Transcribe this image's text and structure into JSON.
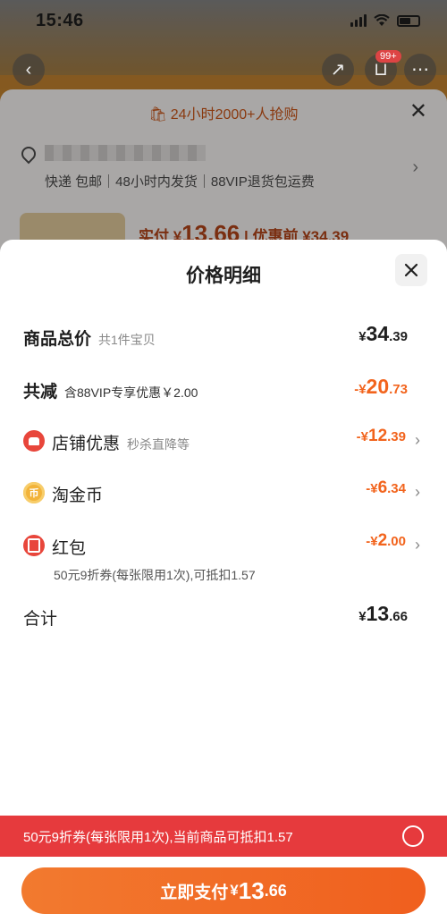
{
  "status_bar": {
    "time": "15:46"
  },
  "background": {
    "badge": "99+",
    "banner_text": "24小时2000+人抢购",
    "delivery_info": "快递 包邮｜48小时内发货｜88VIP退货包运费",
    "pay_label": "实付",
    "pay_currency": "¥",
    "pay_amount": "13.66",
    "before_label": "优惠前",
    "before_amount": "¥34.39"
  },
  "sheet": {
    "title": "价格明细",
    "rows": [
      {
        "label": "商品总价",
        "sub": "共1件宝贝",
        "currency": "¥",
        "int": "34",
        "dec": ".39"
      },
      {
        "label": "共减",
        "sub": "含88VIP专享优惠￥2.00",
        "currency": "-¥",
        "int": "20",
        "dec": ".73"
      },
      {
        "label": "店铺优惠",
        "sub": "秒杀直降等",
        "currency": "-¥",
        "int": "12",
        "dec": ".39"
      },
      {
        "label": "淘金币",
        "sub": "",
        "currency": "-¥",
        "int": "6",
        "dec": ".34"
      },
      {
        "label": "红包",
        "sub": "",
        "currency": "-¥",
        "int": "2",
        "dec": ".00"
      },
      {
        "label": "合计",
        "sub": "",
        "currency": "¥",
        "int": "13",
        "dec": ".66"
      }
    ],
    "coupon_note": "50元9折券(每张限用1次),可抵扣1.57"
  },
  "promo": {
    "text": "50元9折券(每张限用1次),当前商品可抵扣1.57"
  },
  "pay_button": {
    "label": "立即支付",
    "currency": "¥",
    "int": "13",
    "dec": ".66"
  },
  "colors": {
    "accent": "#f2641d",
    "promo_red": "#e63a3d"
  }
}
